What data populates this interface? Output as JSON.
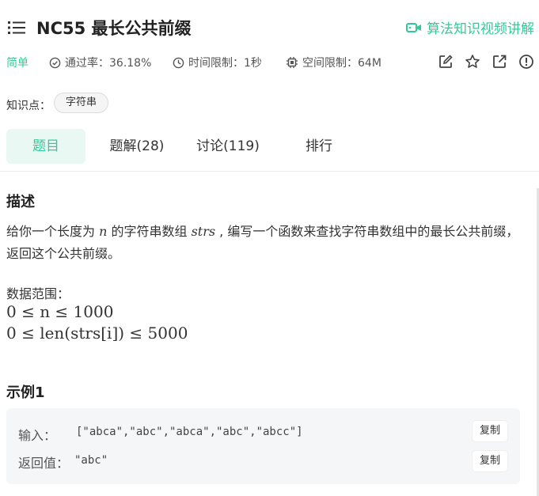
{
  "header": {
    "title": "NC55  最长公共前缀",
    "video_link": "算法知识视频讲解",
    "icons": {
      "menu": "list-icon",
      "video": "video-camera-icon"
    }
  },
  "meta": {
    "difficulty": "简单",
    "pass_rate": "通过率：36.18%",
    "time_limit": "时间限制：1秒",
    "space_limit": "空间限制：64M",
    "accent_color": "#32ca99"
  },
  "knowledge": {
    "label": "知识点：",
    "tags": [
      "字符串"
    ]
  },
  "tabs": [
    {
      "label": "题目",
      "active": true
    },
    {
      "label": "题解(28)",
      "active": false
    },
    {
      "label": "讨论(119)",
      "active": false
    },
    {
      "label": "排行",
      "active": false
    }
  ],
  "description": {
    "heading": "描述",
    "text_1": "给你一个长度为 ",
    "var_n": "n",
    "text_2": " 的字符串数组 ",
    "var_strs": "strs",
    "text_3": " , 编写一个函数来查找字符串数组中的最长公共前缀，返回这个公共前缀。",
    "range_label": "数据范围：",
    "range_1": "0 ≤ n ≤ 1000",
    "range_2": "0 ≤ len(strs[i]) ≤ 5000"
  },
  "example": {
    "heading": "示例1",
    "input_label": "输入：",
    "input_value": "[\"abca\",\"abc\",\"abca\",\"abc\",\"abcc\"]",
    "output_label": "返回值：",
    "output_value": "\"abc\"",
    "copy_label": "复制"
  }
}
